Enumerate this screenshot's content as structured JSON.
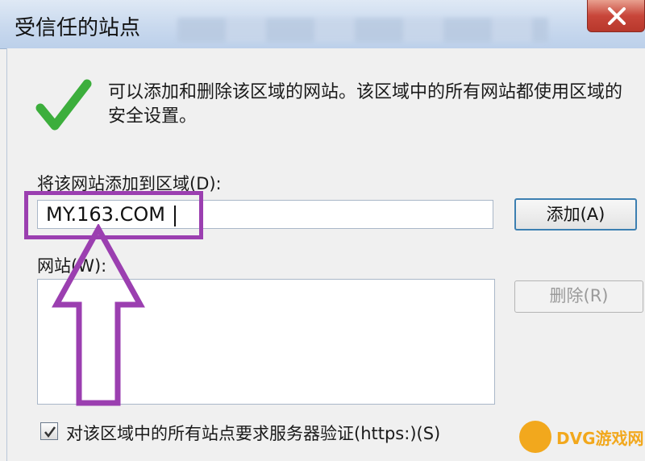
{
  "window": {
    "title": "受信任的站点"
  },
  "description": "可以添加和删除该区域的网站。该区域中的所有网站都使用区域的安全设置。",
  "add_zone": {
    "label": "将该网站添加到区域(D):",
    "value": "MY.163.COM",
    "button": "添加(A)"
  },
  "sites": {
    "label": "网站(W):",
    "remove_button": "删除(R)"
  },
  "https_check": {
    "label": "对该区域中的所有站点要求服务器验证(https:)(S)",
    "checked": true
  },
  "icons": {
    "success": "green-check-icon",
    "close": "close-icon",
    "arrow": "up-arrow-icon"
  },
  "colors": {
    "highlight": "#9b3fb0",
    "check": "#3cae3c",
    "close": "#c8463a"
  },
  "watermark": {
    "text": "DVG游戏网"
  }
}
